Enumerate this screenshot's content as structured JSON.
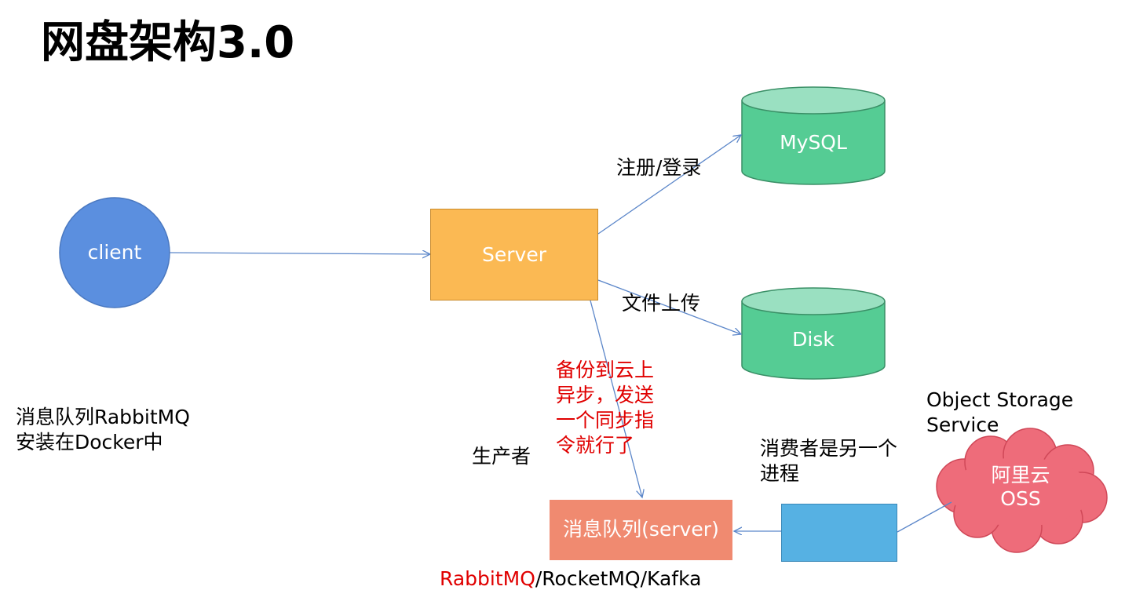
{
  "title": "网盘架构3.0",
  "colors": {
    "client": "#5b8fdf",
    "server": "#fbb953",
    "db": "#55cc94",
    "db_top": "#9ae0c1",
    "queue": "#f08a70",
    "consumer": "#56b1e3",
    "oss": "#ee6c7a",
    "arrow": "#5b86c9",
    "highlight": "#e00000"
  },
  "nodes": {
    "client": "client",
    "server": "Server",
    "mysql": "MySQL",
    "disk": "Disk",
    "queue": "消息队列(server)",
    "oss_line1": "阿里云",
    "oss_line2": "OSS"
  },
  "labels": {
    "register_login": "注册/登录",
    "file_upload": "文件上传",
    "backup_note": [
      "备份到云上",
      "异步，发送",
      "一个同步指",
      "令就行了"
    ],
    "producer": "生产者",
    "consumer_note": [
      "消费者是另一个",
      "进程"
    ],
    "object_storage": [
      "Object Storage",
      "Service"
    ],
    "rabbitmq_note": [
      "消息队列RabbitMQ",
      "安装在Docker中"
    ],
    "mq_options_red": "RabbitMQ",
    "mq_options_rest": "/RocketMQ/Kafka"
  }
}
